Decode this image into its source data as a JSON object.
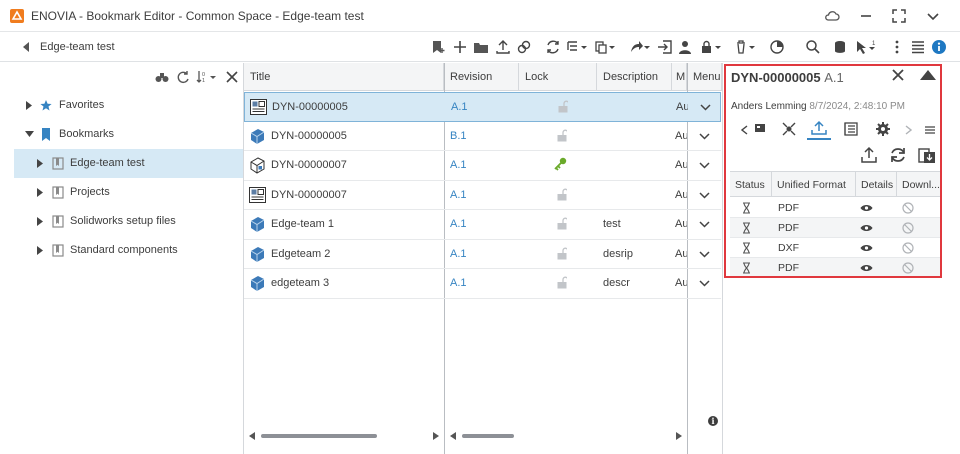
{
  "window": {
    "title": "ENOVIA - Bookmark Editor - Common Space - Edge-team test"
  },
  "toolbar": {
    "breadcrumb": "Edge-team test"
  },
  "tree": {
    "items": [
      {
        "label": "Favorites"
      },
      {
        "label": "Bookmarks"
      },
      {
        "label": "Edge-team test"
      },
      {
        "label": "Projects"
      },
      {
        "label": "Solidworks setup files"
      },
      {
        "label": "Standard components"
      }
    ]
  },
  "grid": {
    "columns": [
      "Title",
      "Revision",
      "Lock",
      "Description",
      "M",
      "Menu"
    ],
    "rows": [
      {
        "title": "DYN-00000005",
        "revision": "A.1",
        "description": "",
        "m": "Aug",
        "lock": "unlocked"
      },
      {
        "title": "DYN-00000005",
        "revision": "B.1",
        "description": "",
        "m": "Aug",
        "lock": "unlocked"
      },
      {
        "title": "DYN-00000007",
        "revision": "A.1",
        "description": "",
        "m": "Aug",
        "lock": "key"
      },
      {
        "title": "DYN-00000007",
        "revision": "A.1",
        "description": "",
        "m": "Aug",
        "lock": "unlocked"
      },
      {
        "title": "Edge-team 1",
        "revision": "A.1",
        "description": "test",
        "m": "Aug",
        "lock": "unlocked"
      },
      {
        "title": "Edgeteam 2",
        "revision": "A.1",
        "description": "desrip",
        "m": "Aug",
        "lock": "unlocked"
      },
      {
        "title": "edgeteam 3",
        "revision": "A.1",
        "description": "descr",
        "m": "Aug",
        "lock": "unlocked"
      }
    ]
  },
  "detail": {
    "title": "DYN-00000005",
    "revision": "A.1",
    "author": "Anders Lemming",
    "date": "8/7/2024, 2:48:10 PM",
    "columns": [
      "Status",
      "Unified Format",
      "Details",
      "Downl..."
    ],
    "rows": [
      {
        "format": "PDF"
      },
      {
        "format": "PDF"
      },
      {
        "format": "DXF"
      },
      {
        "format": "PDF"
      }
    ]
  },
  "info_glyph": "i",
  "colors": {
    "accent": "#3684c2",
    "selection": "#d6e9f5",
    "highlight_frame": "#e0383e",
    "key_green": "#6aaa2a",
    "logo_orange": "#f07c1e"
  }
}
